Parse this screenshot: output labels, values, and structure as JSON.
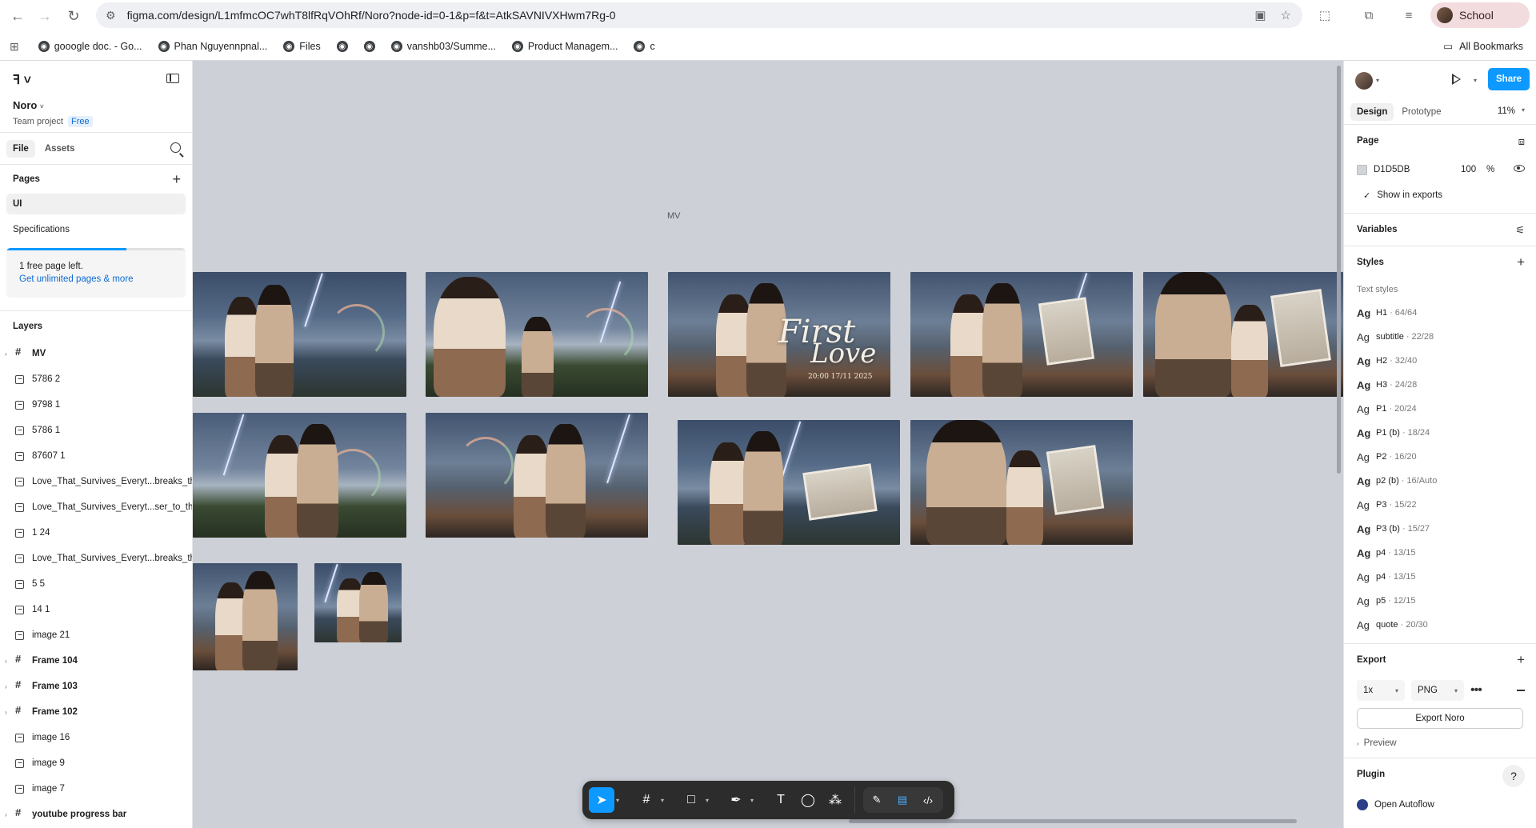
{
  "browser": {
    "url": "figma.com/design/L1mfmcOC7whT8lfRqVOhRf/Noro?node-id=0-1&p=f&t=AtkSAVNIVXHwm7Rg-0",
    "profile_label": "School",
    "bookmarks": [
      "gooogle doc. - Go...",
      "Phan Nguyennpnal...",
      "Files",
      "",
      "",
      "vanshb03/Summe...",
      "Product Managem...",
      "c"
    ],
    "all_bookmarks": "All Bookmarks"
  },
  "left_panel": {
    "file_name": "Noro",
    "team": "Team project",
    "plan_badge": "Free",
    "tabs": [
      "File",
      "Assets"
    ],
    "pages_title": "Pages",
    "pages": [
      "UI",
      "Specifications"
    ],
    "upsell": {
      "line1": "1 free page left.",
      "line2": "Get unlimited pages & more",
      "progress": 0.67
    },
    "layers_title": "Layers",
    "layers": [
      {
        "name": "MV",
        "type": "frame",
        "bold": true,
        "caret": true
      },
      {
        "name": "5786 2",
        "type": "image"
      },
      {
        "name": "9798 1",
        "type": "image"
      },
      {
        "name": "5786 1",
        "type": "image"
      },
      {
        "name": "87607 1",
        "type": "image"
      },
      {
        "name": "Love_That_Survives_Everyt...breaks_th",
        "type": "image"
      },
      {
        "name": "Love_That_Survives_Everyt...ser_to_the",
        "type": "image"
      },
      {
        "name": "1 24",
        "type": "image"
      },
      {
        "name": "Love_That_Survives_Everyt...breaks_th",
        "type": "image"
      },
      {
        "name": "5 5",
        "type": "image"
      },
      {
        "name": "14 1",
        "type": "image"
      },
      {
        "name": "image 21",
        "type": "image"
      },
      {
        "name": "Frame 104",
        "type": "frame",
        "bold": true,
        "caret": true
      },
      {
        "name": "Frame 103",
        "type": "frame",
        "bold": true,
        "caret": true
      },
      {
        "name": "Frame 102",
        "type": "frame",
        "bold": true,
        "caret": true
      },
      {
        "name": "image 16",
        "type": "image"
      },
      {
        "name": "image 9",
        "type": "image"
      },
      {
        "name": "image 7",
        "type": "image"
      },
      {
        "name": "youtube progress bar",
        "type": "frame",
        "bold": true,
        "caret": true
      }
    ]
  },
  "canvas": {
    "frame_label": "MV",
    "title_art": {
      "title_line1": "First",
      "title_line2": "Love",
      "date": "20:00 17/11 2025"
    }
  },
  "right_panel": {
    "share_label": "Share",
    "tabs": [
      "Design",
      "Prototype"
    ],
    "zoom": "11%",
    "page": {
      "title": "Page",
      "fill_hex": "D1D5DB",
      "opacity": "100",
      "pct": "%",
      "show_in_exports": "Show in exports",
      "fill_color": "#d1d5db"
    },
    "variables_title": "Variables",
    "styles_title": "Styles",
    "text_styles_label": "Text styles",
    "text_styles": [
      {
        "ag": "Ag",
        "name": "H1",
        "meta": "64/64",
        "bold": true
      },
      {
        "ag": "Ag",
        "name": "subtitle",
        "meta": "22/28",
        "bold": false
      },
      {
        "ag": "Ag",
        "name": "H2",
        "meta": "32/40",
        "bold": true
      },
      {
        "ag": "Ag",
        "name": "H3",
        "meta": "24/28",
        "bold": true
      },
      {
        "ag": "Ag",
        "name": "P1",
        "meta": "20/24",
        "bold": false
      },
      {
        "ag": "Ag",
        "name": "P1 (b)",
        "meta": "18/24",
        "bold": true
      },
      {
        "ag": "Ag",
        "name": "P2",
        "meta": "16/20",
        "bold": false
      },
      {
        "ag": "Ag",
        "name": "p2 (b)",
        "meta": "16/Auto",
        "bold": true
      },
      {
        "ag": "Ag",
        "name": "P3",
        "meta": "15/22",
        "bold": false
      },
      {
        "ag": "Ag",
        "name": "P3 (b)",
        "meta": "15/27",
        "bold": true
      },
      {
        "ag": "Ag",
        "name": "p4",
        "meta": "13/15",
        "bold": true
      },
      {
        "ag": "Ag",
        "name": "p4",
        "meta": "13/15",
        "bold": false
      },
      {
        "ag": "Ag",
        "name": "p5",
        "meta": "12/15",
        "bold": false
      },
      {
        "ag": "Ag",
        "name": "quote",
        "meta": "20/30",
        "bold": false
      }
    ],
    "export": {
      "title": "Export",
      "scale": "1x",
      "format": "PNG",
      "button": "Export Noro",
      "preview": "Preview"
    },
    "plugin": {
      "title": "Plugin",
      "item": "Open Autoflow",
      "help": "?"
    }
  },
  "colors": {
    "accent": "#0d99ff",
    "canvas_bg": "#cdd0d7",
    "toolbar_bg": "#2c2c2c"
  },
  "icons": [
    "back-arrow-icon",
    "forward-arrow-icon",
    "reload-icon",
    "site-info-icon",
    "star-icon",
    "extensions-icon",
    "figma-menu-icon",
    "panel-toggle-icon",
    "search-icon",
    "plus-icon",
    "frame-icon",
    "image-icon",
    "move-tool-icon",
    "frame-tool-icon",
    "rectangle-tool-icon",
    "pen-tool-icon",
    "text-tool-icon",
    "comment-tool-icon",
    "actions-icon",
    "draw-mode-icon",
    "design-mode-icon",
    "dev-mode-icon",
    "play-icon",
    "eye-icon",
    "variables-icon",
    "help-icon"
  ]
}
